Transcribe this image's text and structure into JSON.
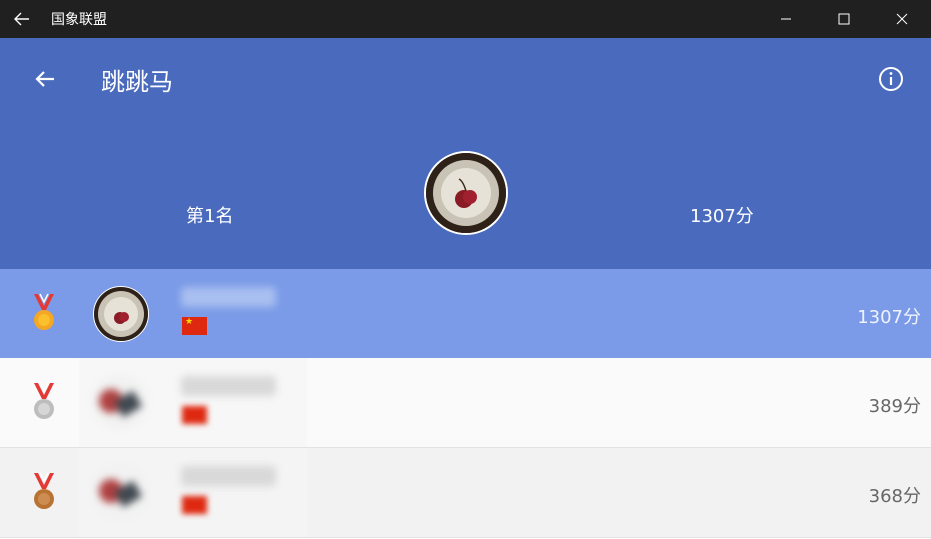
{
  "window": {
    "title": "国象联盟"
  },
  "header": {
    "title": "跳跳马",
    "rank": "第1名",
    "score": "1307分"
  },
  "rows": [
    {
      "score": "1307分",
      "medal": "gold",
      "medal_color": "#f5a623"
    },
    {
      "score": "389分",
      "medal": "silver",
      "medal_color": "#c0c0c0"
    },
    {
      "score": "368分",
      "medal": "bronze",
      "medal_color": "#b87333"
    }
  ],
  "colors": {
    "titlebar": "#202020",
    "header": "#4a6bbd",
    "highlight_row": "#7b9be8"
  }
}
